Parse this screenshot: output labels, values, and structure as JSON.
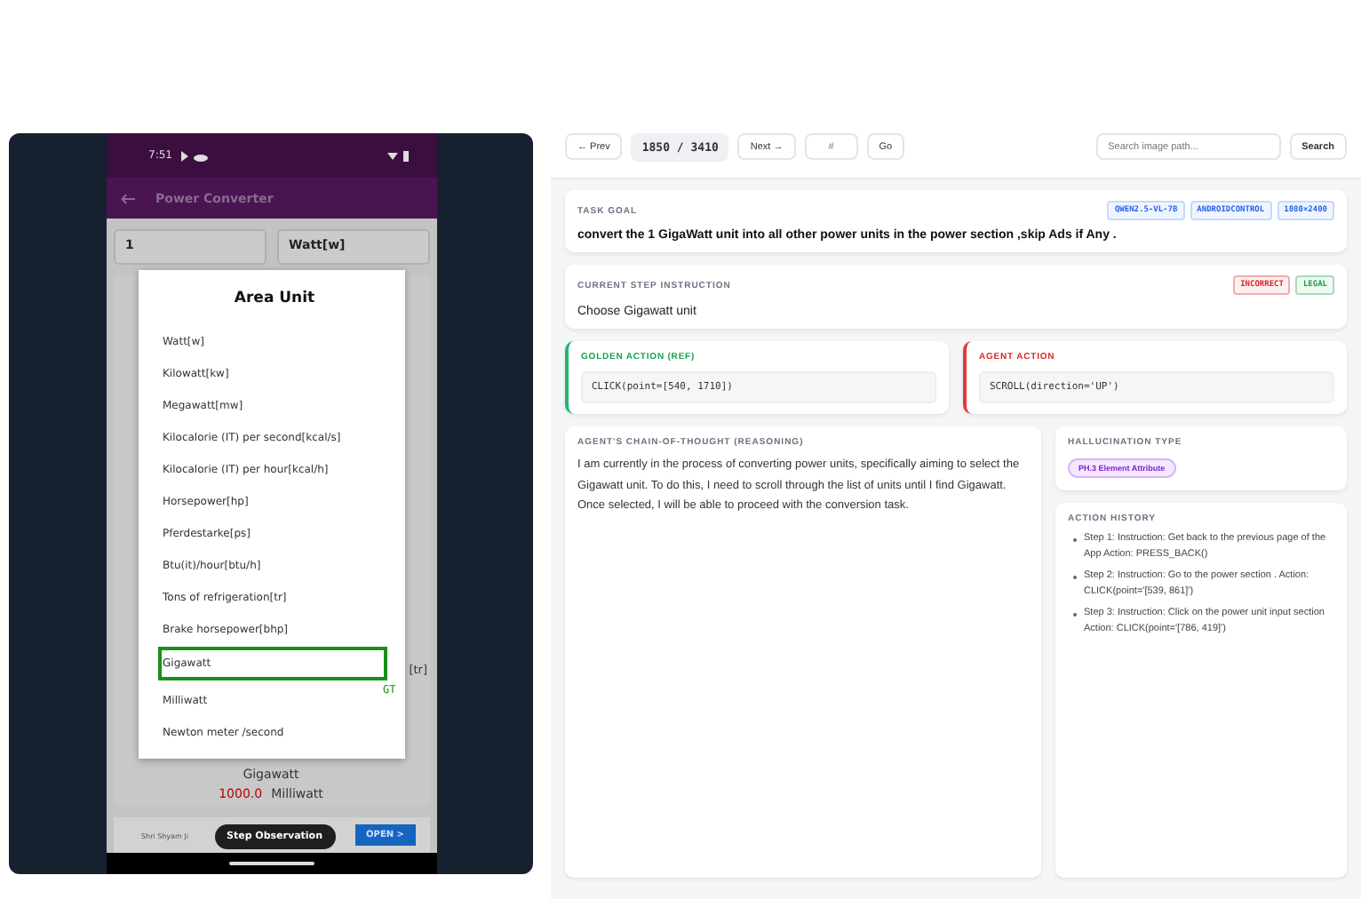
{
  "phone": {
    "status_time": "7:51",
    "app_title": "Power Converter",
    "input_value": "1",
    "unit_value": "Watt[w]",
    "fragment": "[tr]",
    "results": [
      {
        "unit": "Gigawatt"
      },
      {
        "value": "1000.0",
        "unit": "Milliwatt"
      }
    ],
    "ad": {
      "text": "Shri Shyam Ji",
      "button": "OPEN >"
    },
    "dialog": {
      "title": "Area Unit",
      "marker_label": "GT",
      "options": [
        {
          "label": "Watt[w]",
          "marked": false
        },
        {
          "label": "Kilowatt[kw]",
          "marked": false
        },
        {
          "label": "Megawatt[mw]",
          "marked": false
        },
        {
          "label": "Kilocalorie (IT) per second[kcal/s]",
          "marked": false
        },
        {
          "label": "Kilocalorie (IT) per hour[kcal/h]",
          "marked": false
        },
        {
          "label": "Horsepower[hp]",
          "marked": false
        },
        {
          "label": "Pferdestarke[ps]",
          "marked": false
        },
        {
          "label": "Btu(it)/hour[btu/h]",
          "marked": false
        },
        {
          "label": "Tons of refrigeration[tr]",
          "marked": false
        },
        {
          "label": "Brake horsepower[bhp]",
          "marked": false
        },
        {
          "label": "Gigawatt",
          "marked": true
        },
        {
          "label": "Milliwatt",
          "marked": false
        },
        {
          "label": "Newton meter /second",
          "marked": false
        }
      ]
    },
    "overlay_pill": "Step Observation"
  },
  "toolbar": {
    "prev": "← Prev",
    "counter": "1850 / 3410",
    "next": "Next →",
    "jump_placeholder": "#",
    "go": "Go",
    "search_placeholder": "Search image path...",
    "search": "Search"
  },
  "task": {
    "heading": "TASK GOAL",
    "tags": [
      "QWEN2.5-VL-7B",
      "ANDROIDCONTROL",
      "1080×2400"
    ],
    "text": "convert the 1 GigaWatt unit into all other power units in the power section ,skip Ads if Any ."
  },
  "step": {
    "heading": "CURRENT STEP INSTRUCTION",
    "tags": [
      {
        "label": "INCORRECT",
        "color": "#dc2626"
      },
      {
        "label": "LEGAL",
        "color": "#16a34a"
      }
    ],
    "text": "Choose Gigawatt unit"
  },
  "actions": [
    {
      "kind": "golden",
      "heading": "GOLDEN ACTION (REF)",
      "code": "CLICK(point=[540, 1710])"
    },
    {
      "kind": "agent",
      "heading": "AGENT ACTION",
      "code": "SCROLL(direction='UP')"
    }
  ],
  "reasoning": {
    "heading": "AGENT'S CHAIN-OF-THOUGHT (REASONING)",
    "text": "I am currently in the process of converting power units, specifically aiming to select the Gigawatt unit. To do this, I need to scroll through the list of units until I find Gigawatt. Once selected, I will be able to proceed with the conversion task."
  },
  "hallucination": {
    "heading": "HALLUCINATION TYPE",
    "tag": "PH.3 Element Attribute"
  },
  "history": {
    "heading": "ACTION HISTORY",
    "items": [
      "Step 1: Instruction: Get back to the previous page of the App Action: PRESS_BACK()",
      "Step 2: Instruction: Go to the power section . Action: CLICK(point='[539, 861]')",
      "Step 3: Instruction: Click on the power unit input section Action: CLICK(point='[786, 419]')"
    ]
  }
}
